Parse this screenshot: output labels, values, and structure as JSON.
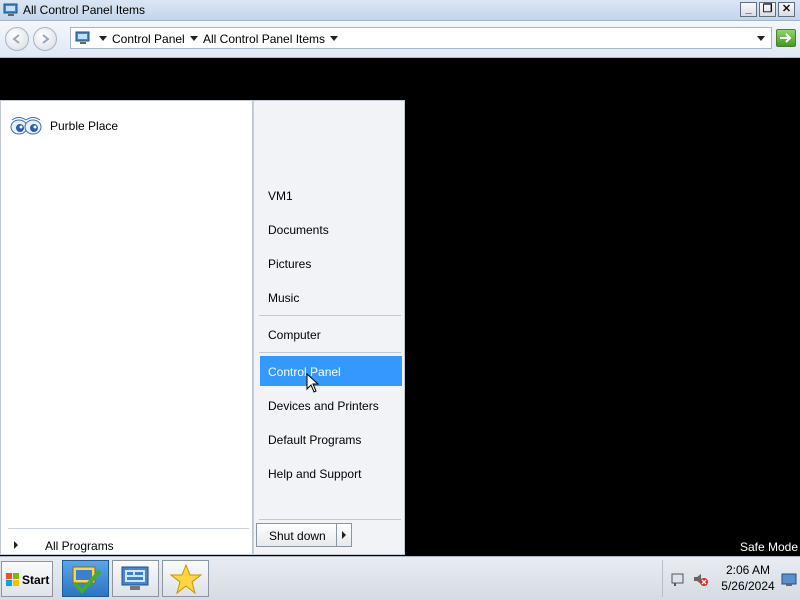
{
  "window": {
    "title": "All Control Panel Items",
    "minimize_label": "_",
    "restore_label": "❐",
    "close_label": "✕"
  },
  "address": {
    "crumbs": [
      "Control Panel",
      "All Control Panel Items"
    ]
  },
  "start_menu": {
    "programs": [
      {
        "label": "Purble Place",
        "icon": "purble-place-eyes-icon"
      }
    ],
    "all_programs_label": "All Programs",
    "right_items": [
      {
        "label": "VM1"
      },
      {
        "label": "Documents"
      },
      {
        "label": "Pictures"
      },
      {
        "label": "Music"
      },
      {
        "label": "Computer"
      },
      {
        "label": "Control Panel",
        "selected": true
      },
      {
        "label": "Devices and Printers"
      },
      {
        "label": "Default Programs"
      },
      {
        "label": "Help and Support"
      }
    ],
    "shutdown_label": "Shut down"
  },
  "desktop": {
    "safe_mode_label": "Safe Mode"
  },
  "taskbar": {
    "start_label": "Start",
    "pinned": [
      {
        "icon": "windows-tasks-checkmark-icon",
        "active": true
      },
      {
        "icon": "control-panel-icon",
        "active": false
      },
      {
        "icon": "star-favorites-icon",
        "active": false
      }
    ],
    "clock_time": "2:06 AM",
    "clock_date": "5/26/2024"
  },
  "colors": {
    "selection": "#3399ff",
    "desktop": "#000000"
  }
}
